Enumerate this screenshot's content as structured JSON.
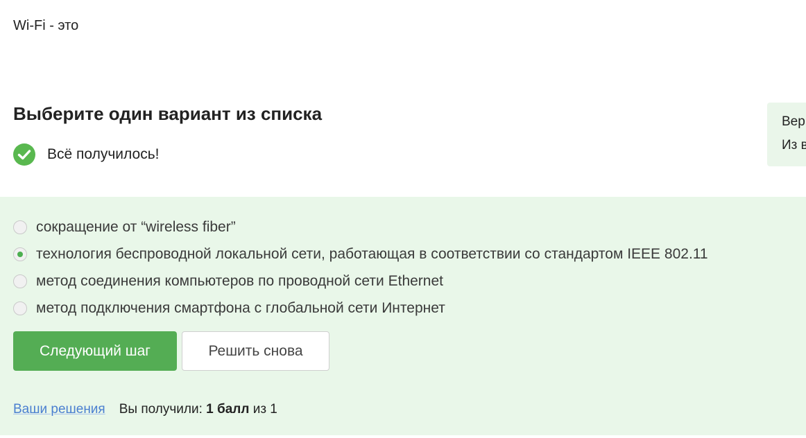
{
  "question": {
    "text": "Wi-Fi - это"
  },
  "task": {
    "heading": "Выберите один вариант из списка",
    "result_text": "Всё получилось!"
  },
  "side_panel": {
    "line1": "Вер",
    "line2": "Из в"
  },
  "options": [
    {
      "label": "сокращение от “wireless fiber”",
      "selected": false
    },
    {
      "label": "технология беспроводной локальной сети, работающая в соответствии со стандартом IEEE 802.11",
      "selected": true
    },
    {
      "label": "метод соединения компьютеров по проводной сети Ethernet",
      "selected": false
    },
    {
      "label": "метод подключения смартфона с глобальной сети Интернет",
      "selected": false
    }
  ],
  "buttons": {
    "next_label": "Следующий шаг",
    "retry_label": "Решить снова"
  },
  "footer": {
    "solutions_link": "Ваши решения",
    "score_prefix": "Вы получили:",
    "score_value": "1 балл",
    "score_suffix": "из 1"
  },
  "colors": {
    "accent_green": "#54ad54",
    "answer_background": "#e9f7e9",
    "link_blue": "#4a7fd0"
  },
  "icons": {
    "result": "check-circle-icon"
  }
}
